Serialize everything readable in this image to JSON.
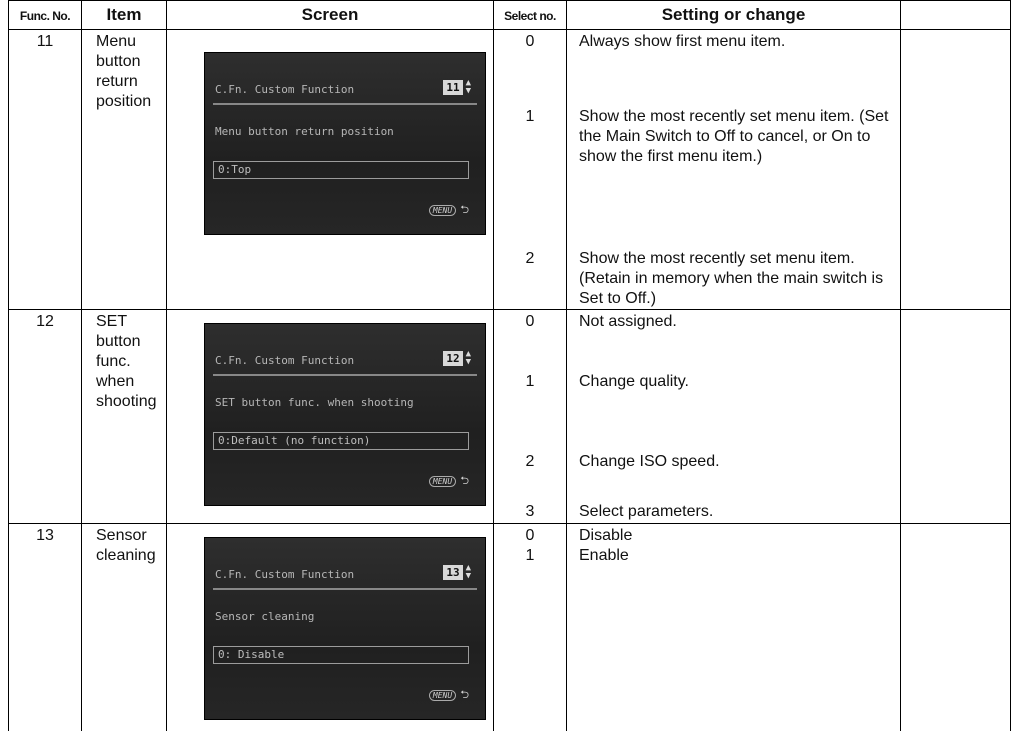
{
  "headers": {
    "func_no": "Func. No.",
    "item": "Item",
    "screen": "Screen",
    "select_no": "Select no.",
    "setting": "Setting or change"
  },
  "rows": [
    {
      "func_no": "11",
      "item": "Menu\nbutton\nreturn\nposition",
      "screen": {
        "title": "C.Fn. Custom Function",
        "number": "11",
        "description": "Menu button return position",
        "value": "0:Top",
        "menu_label": "MENU"
      },
      "options": [
        {
          "no": "0",
          "text": "Always show first menu item."
        },
        {
          "no": "1",
          "text": "Show the most recently set menu item. (Set the Main Switch to Off to cancel, or On to show the first menu item.)"
        },
        {
          "no": "2",
          "text": "Show the most recently set menu item. (Retain in memory when the main switch is Set to Off.)"
        }
      ]
    },
    {
      "func_no": "12",
      "item": "SET\nbutton\nfunc.\nwhen\nshooting",
      "screen": {
        "title": "C.Fn. Custom Function",
        "number": "12",
        "description": "SET button func. when shooting",
        "value": "0:Default (no function)",
        "menu_label": "MENU"
      },
      "options": [
        {
          "no": "0",
          "text": "Not assigned."
        },
        {
          "no": "1",
          "text": "Change quality."
        },
        {
          "no": "2",
          "text": "Change ISO speed."
        },
        {
          "no": "3",
          "text": "Select parameters."
        }
      ]
    },
    {
      "func_no": "13",
      "item": "Sensor\ncleaning",
      "screen": {
        "title": "C.Fn. Custom Function",
        "number": "13",
        "description": "Sensor cleaning",
        "value": "0: Disable",
        "menu_label": "MENU"
      },
      "options": [
        {
          "no": "0",
          "text": "Disable"
        },
        {
          "no": "1",
          "text": "Enable"
        }
      ]
    }
  ]
}
